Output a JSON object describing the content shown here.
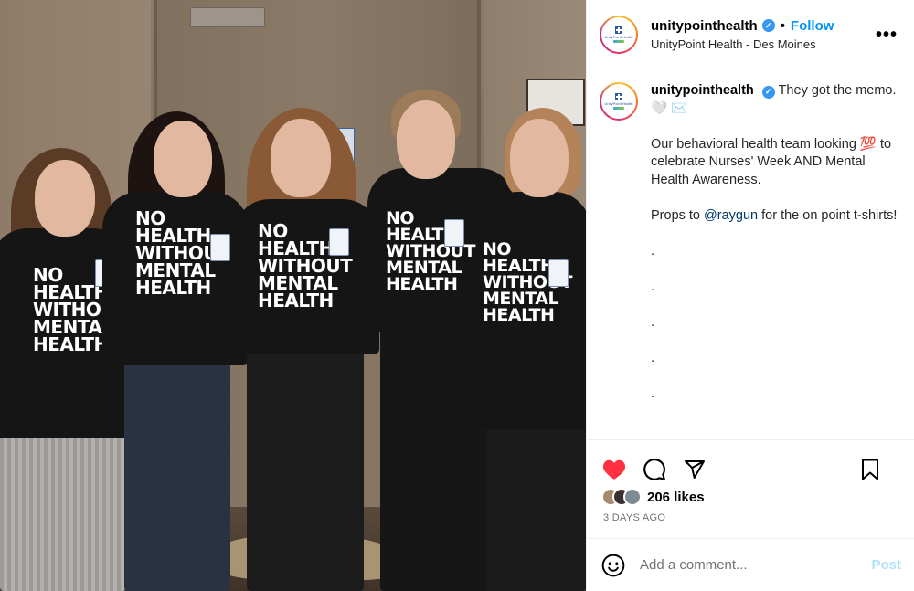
{
  "header": {
    "username": "unitypointhealth",
    "follow_label": "Follow",
    "separator": "•",
    "location": "UnityPoint Health - Des Moines",
    "more_icon": "more-horizontal-icon",
    "verified_icon": "verified-badge-icon"
  },
  "avatar": {
    "logo_text": "UnityPoint Health"
  },
  "caption": {
    "username": "unitypointhealth",
    "line1": "They got the memo. 🤍 ✉️",
    "line2": "Our behavioral health team looking 💯 to celebrate Nurses' Week AND Mental Health Awareness.",
    "line3_prefix": "Props to ",
    "line3_mention": "@raygun",
    "line3_suffix": " for the on point t-shirts!",
    "dots": [
      ".",
      ".",
      ".",
      ".",
      "."
    ]
  },
  "photo": {
    "shirt_text": "NO\nHEALTH\nWITHOUT\nMENTAL\nHEALTH"
  },
  "actions": {
    "like_icon": "heart-filled-icon",
    "comment_icon": "comment-bubble-icon",
    "share_icon": "paper-plane-icon",
    "save_icon": "bookmark-icon",
    "like_color": "#ff3040"
  },
  "likes": {
    "count_text": "206 likes"
  },
  "timestamp": "3 DAYS AGO",
  "comment_box": {
    "placeholder": "Add a comment...",
    "post_label": "Post",
    "emoji_icon": "smiley-icon"
  },
  "colors": {
    "link_blue": "#0095f6",
    "verified_blue": "#3897f0",
    "post_disabled": "#b2dffc"
  }
}
